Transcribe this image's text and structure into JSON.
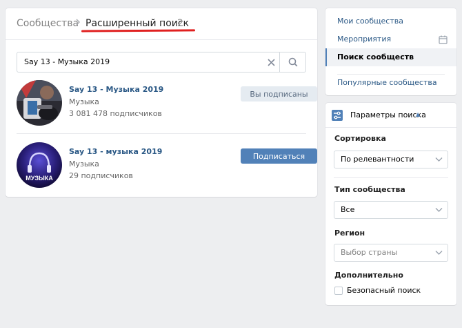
{
  "breadcrumb": {
    "root": "Сообщества",
    "separator": ">",
    "current": "Расширенный поиск",
    "count": "2"
  },
  "search": {
    "value": "Say 13 - Музыка 2019"
  },
  "results": [
    {
      "title": "Say 13 - Музыка 2019",
      "category": "Музыка",
      "subscribers": "3 081 478 подписчиков",
      "button": "Вы подписаны"
    },
    {
      "title": "Say 13 - музыка 2019",
      "category": "Музыка",
      "subscribers": "29 подписчиков",
      "button": "Подписаться",
      "avatar_text": "МУЗЫКА"
    }
  ],
  "nav": {
    "items": [
      "Мои сообщества",
      "Мероприятия",
      "Поиск сообществ",
      "Популярные сообщества"
    ],
    "selected": "Поиск сообществ"
  },
  "params": {
    "title": "Параметры поиска",
    "sort_label": "Сортировка",
    "sort_value": "По релевантности",
    "type_label": "Тип сообщества",
    "type_value": "Все",
    "region_label": "Регион",
    "region_placeholder": "Выбор страны",
    "extra_label": "Дополнительно",
    "safe_search": "Безопасный поиск"
  },
  "colors": {
    "accent": "#5181b8",
    "link": "#2a5885",
    "highlight_underline": "#e02020"
  }
}
